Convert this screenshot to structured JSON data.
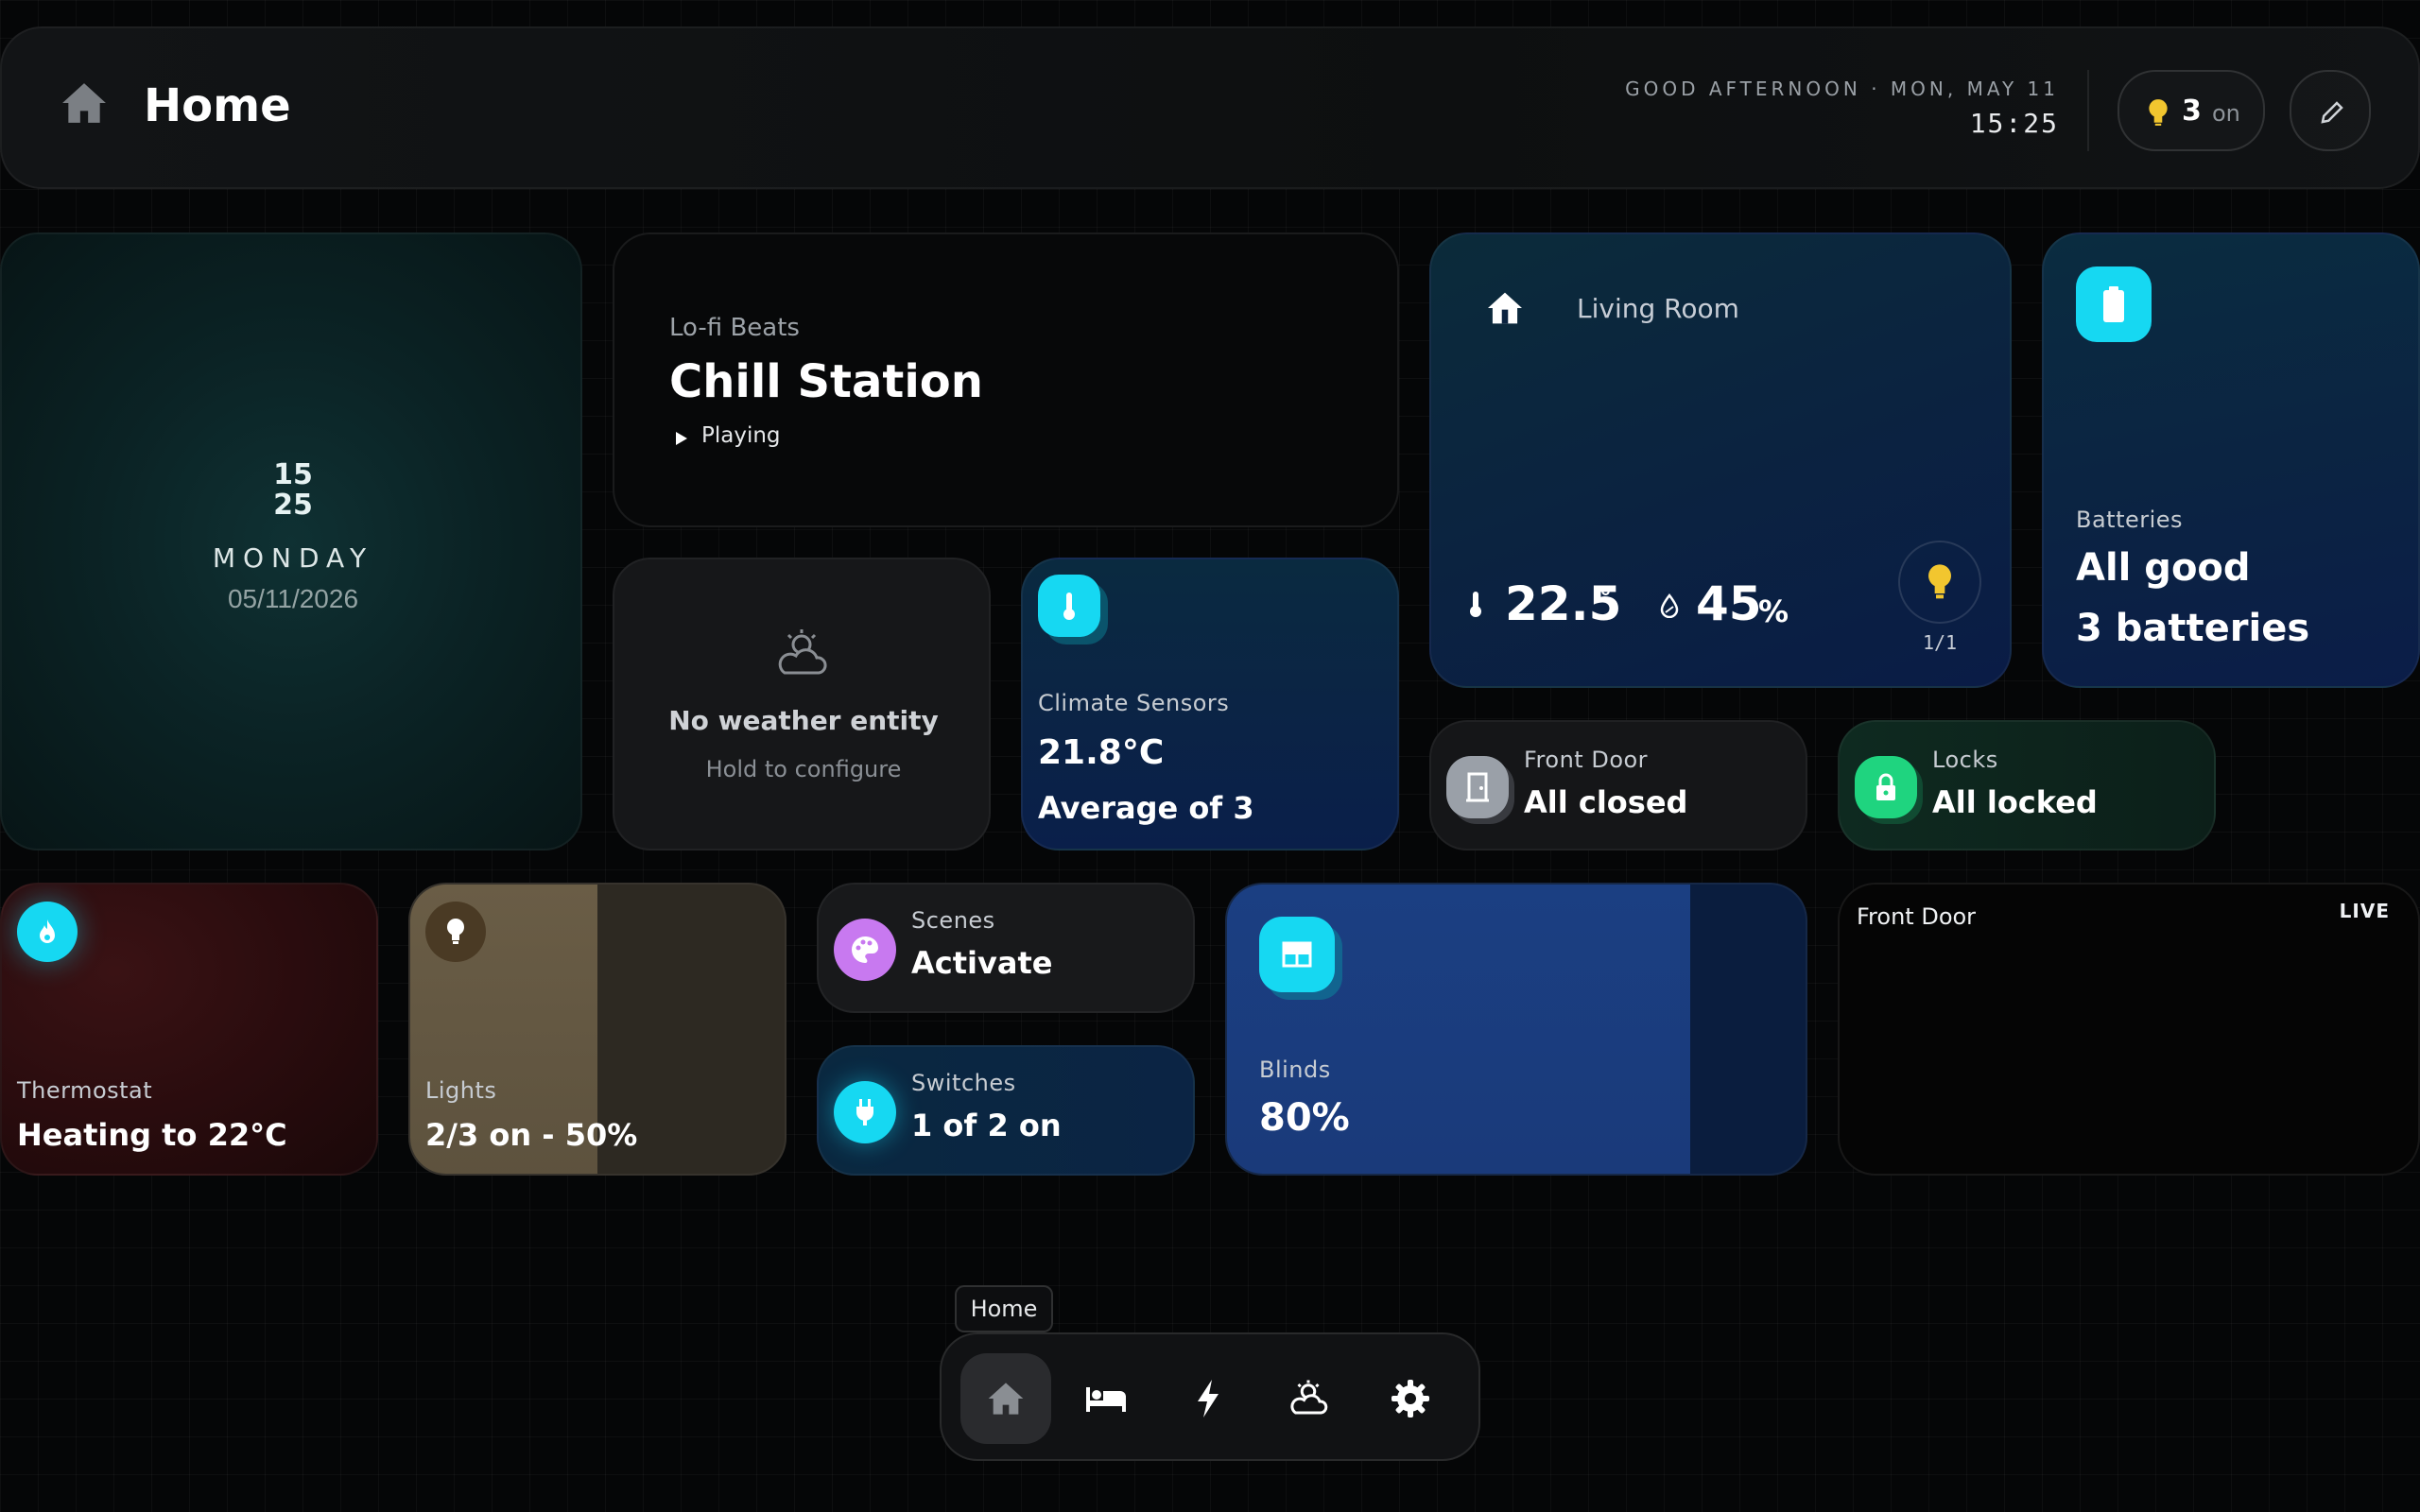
{
  "header": {
    "title": "Home",
    "greeting": "GOOD AFTERNOON · MON, MAY 11",
    "time": "15:25",
    "lights_on_count": "3",
    "lights_on_suffix": "on",
    "icons": {
      "home": "home-icon",
      "bulb": "bulb-icon",
      "edit": "pencil-icon"
    }
  },
  "clock_card": {
    "hour": "15",
    "minute": "25",
    "weekday": "MONDAY",
    "date": "05/11/2026"
  },
  "media_card": {
    "subtitle": "Lo-fi Beats",
    "title": "Chill Station",
    "status": "Playing"
  },
  "weather_card": {
    "title": "No weather entity",
    "hint": "Hold to configure"
  },
  "climate_card": {
    "label": "Climate Sensors",
    "value": "21.8°C",
    "detail": "Average of 3"
  },
  "room_card": {
    "name": "Living Room",
    "temperature": "22.5",
    "temperature_unit": "°",
    "humidity": "45",
    "humidity_unit": "%",
    "lights": "1/1"
  },
  "battery_card": {
    "label": "Batteries",
    "status": "All good",
    "count": "3 batteries"
  },
  "front_door_card": {
    "label": "Front Door",
    "value": "All closed"
  },
  "locks_card": {
    "label": "Locks",
    "value": "All locked"
  },
  "thermostat_card": {
    "label": "Thermostat",
    "value": "Heating to 22°C"
  },
  "lights_card": {
    "label": "Lights",
    "value": "2/3 on - 50%",
    "brightness_fraction": 0.5
  },
  "scenes_card": {
    "label": "Scenes",
    "value": "Activate"
  },
  "switches_card": {
    "label": "Switches",
    "value": "1 of 2 on"
  },
  "blinds_card": {
    "label": "Blinds",
    "value": "80%",
    "position_fraction": 0.8
  },
  "camera_card": {
    "title": "Front Door",
    "badge": "LIVE"
  },
  "dock": {
    "tooltip": "Home",
    "items": [
      "home-icon",
      "bed-icon",
      "bolt-icon",
      "weather-icon",
      "gear-icon"
    ]
  },
  "colors": {
    "accent_cyan": "#16d8f2",
    "accent_green": "#1fd47f",
    "accent_purple": "#c879f0",
    "accent_yellow": "#f2c62f",
    "background": "#050607"
  }
}
